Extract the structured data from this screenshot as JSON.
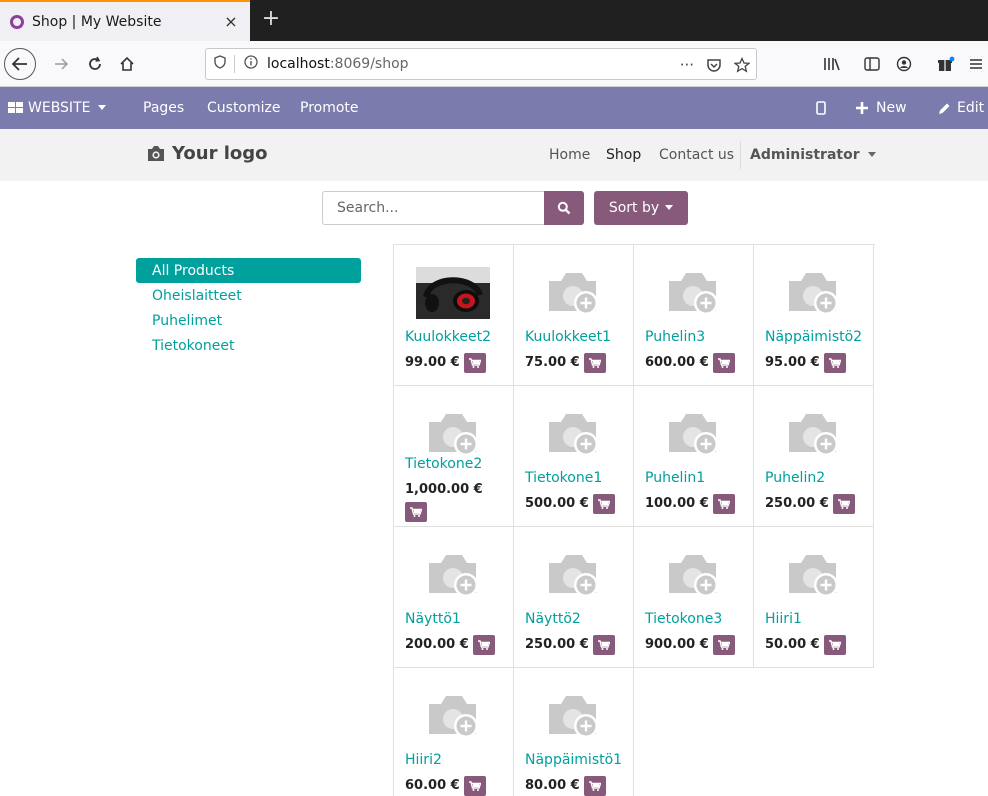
{
  "browser": {
    "tab_title": "Shop | My Website",
    "tab_close": "×",
    "new_tab": "+",
    "url_host": "localhost",
    "url_rest": ":8069/shop",
    "page_actions": "···"
  },
  "odoo_bar": {
    "website_menu": "WEBSITE",
    "pages": "Pages",
    "customize": "Customize",
    "promote": "Promote",
    "new": "New",
    "edit": "Edit"
  },
  "header": {
    "logo_text": "Your logo",
    "menu": {
      "home": "Home",
      "shop": "Shop",
      "contact": "Contact us"
    },
    "user": "Administrator"
  },
  "search": {
    "placeholder": "Search...",
    "sort_label": "Sort by"
  },
  "categories": [
    "All Products",
    "Oheislaitteet",
    "Puhelimet",
    "Tietokoneet"
  ],
  "active_category": "All Products",
  "products": [
    {
      "name": "Kuulokkeet2",
      "price": "99.00 €",
      "image": "headphones-photo"
    },
    {
      "name": "Kuulokkeet1",
      "price": "75.00 €",
      "image": "placeholder-camera"
    },
    {
      "name": "Puhelin3",
      "price": "600.00 €",
      "image": "placeholder-camera"
    },
    {
      "name": "Näppäimistö2",
      "price": "95.00 €",
      "image": "placeholder-camera"
    },
    {
      "name": "Tietokone2",
      "price": "1,000.00 €",
      "image": "placeholder-camera"
    },
    {
      "name": "Tietokone1",
      "price": "500.00 €",
      "image": "placeholder-camera"
    },
    {
      "name": "Puhelin1",
      "price": "100.00 €",
      "image": "placeholder-camera"
    },
    {
      "name": "Puhelin2",
      "price": "250.00 €",
      "image": "placeholder-camera"
    },
    {
      "name": "Näyttö1",
      "price": "200.00 €",
      "image": "placeholder-camera"
    },
    {
      "name": "Näyttö2",
      "price": "250.00 €",
      "image": "placeholder-camera"
    },
    {
      "name": "Tietokone3",
      "price": "900.00 €",
      "image": "placeholder-camera"
    },
    {
      "name": "Hiiri1",
      "price": "50.00 €",
      "image": "placeholder-camera"
    },
    {
      "name": "Hiiri2",
      "price": "60.00 €",
      "image": "placeholder-camera"
    },
    {
      "name": "Näppäimistö1",
      "price": "80.00 €",
      "image": "placeholder-camera"
    }
  ],
  "colors": {
    "odoo_bar": "#7c7bad",
    "primary_button": "#875a7b",
    "link_teal": "#00a09d"
  }
}
